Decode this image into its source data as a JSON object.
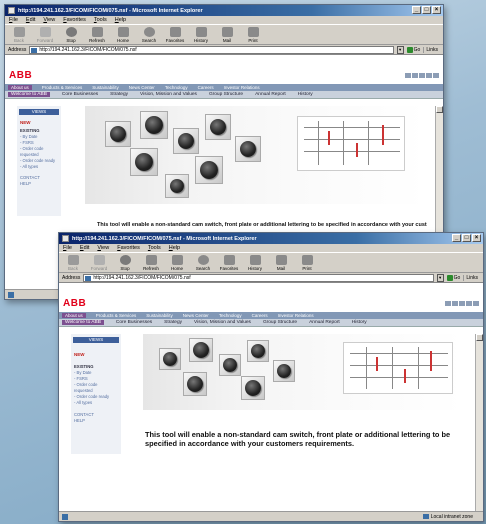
{
  "browser": {
    "title": "http://194.241.162.3/FICOM/FICOM/075.nsf - Microsoft Internet Explorer",
    "menu": [
      "File",
      "Edit",
      "View",
      "Favorites",
      "Tools",
      "Help"
    ],
    "toolbar": [
      "Back",
      "Forward",
      "Stop",
      "Refresh",
      "Home",
      "Search",
      "Favorites",
      "History",
      "Mail",
      "Print"
    ],
    "address_label": "Address",
    "address_value": "http://194.241.162.3/FICOM/FICOM/075.nsf",
    "go_label": "Go",
    "links_label": "Links",
    "status_zone": "Local intranet zone"
  },
  "site": {
    "logo": "ABB",
    "nav_primary": [
      "About us",
      "Products & Services",
      "Sustainability",
      "News Center",
      "Technology",
      "Careers",
      "Investor Relations"
    ],
    "nav_secondary": [
      "Welcome to ABB",
      "Core Businesses",
      "Strategy",
      "Vision, Mission and Values",
      "Group Structure",
      "Annual Report",
      "History"
    ],
    "sidebar": {
      "heading": "VIEWS",
      "new_label": "NEW",
      "section": "EXISTING",
      "items": [
        "- By Date",
        "- FSRS",
        "- Order code",
        "  requested",
        "- Order code ready",
        "- All types"
      ],
      "contact": "CONTACT",
      "help": "HELP"
    },
    "caption": "This tool will enable a non-standard cam switch, front plate or additional lettering to be specified in accordance with your customers requirements."
  },
  "colors": {
    "title_bar": "#0a246a",
    "logo_red": "#e1001a",
    "nav_primary_bg": "#8298b6",
    "nav_active": "#7c5090",
    "sidebar_heading": "#3d5f9a"
  }
}
